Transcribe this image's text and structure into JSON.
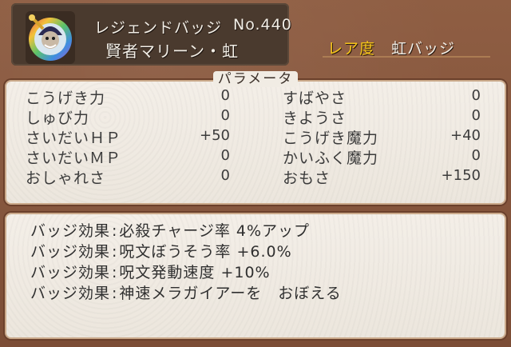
{
  "header": {
    "type_label": "レジェンドバッジ",
    "number": "No.440",
    "name": "賢者マリーン・虹",
    "rarity_label": "レア度",
    "rarity_value": "虹バッジ"
  },
  "params": {
    "title": "パラメータ",
    "left": [
      {
        "label": "こうげき力",
        "value": "0"
      },
      {
        "label": "しゅび力",
        "value": "0"
      },
      {
        "label": "さいだいＨＰ",
        "value": "+50"
      },
      {
        "label": "さいだいＭＰ",
        "value": "0"
      },
      {
        "label": "おしゃれさ",
        "value": "0"
      }
    ],
    "right": [
      {
        "label": "すばやさ",
        "value": "0"
      },
      {
        "label": "きようさ",
        "value": "0"
      },
      {
        "label": "こうげき魔力",
        "value": "+40"
      },
      {
        "label": "かいふく魔力",
        "value": "0"
      },
      {
        "label": "おもさ",
        "value": "+150"
      }
    ]
  },
  "effects": [
    {
      "prefix": "バッジ効果",
      "text": "必殺チャージ率 4%アップ"
    },
    {
      "prefix": "バッジ効果",
      "text": "呪文ぼうそう率 +6.0%"
    },
    {
      "prefix": "バッジ効果",
      "text": "呪文発動速度 +10%"
    },
    {
      "prefix": "バッジ効果",
      "text": "神速メラガイアーを　おぼえる"
    }
  ],
  "colors": {
    "frame": "#8a5a3f",
    "header_bg": "#4a3a2e",
    "panel_bg": "#f1ece4",
    "rarity_label": "#f5c419"
  },
  "icons": [
    "badge-portrait-icon"
  ]
}
